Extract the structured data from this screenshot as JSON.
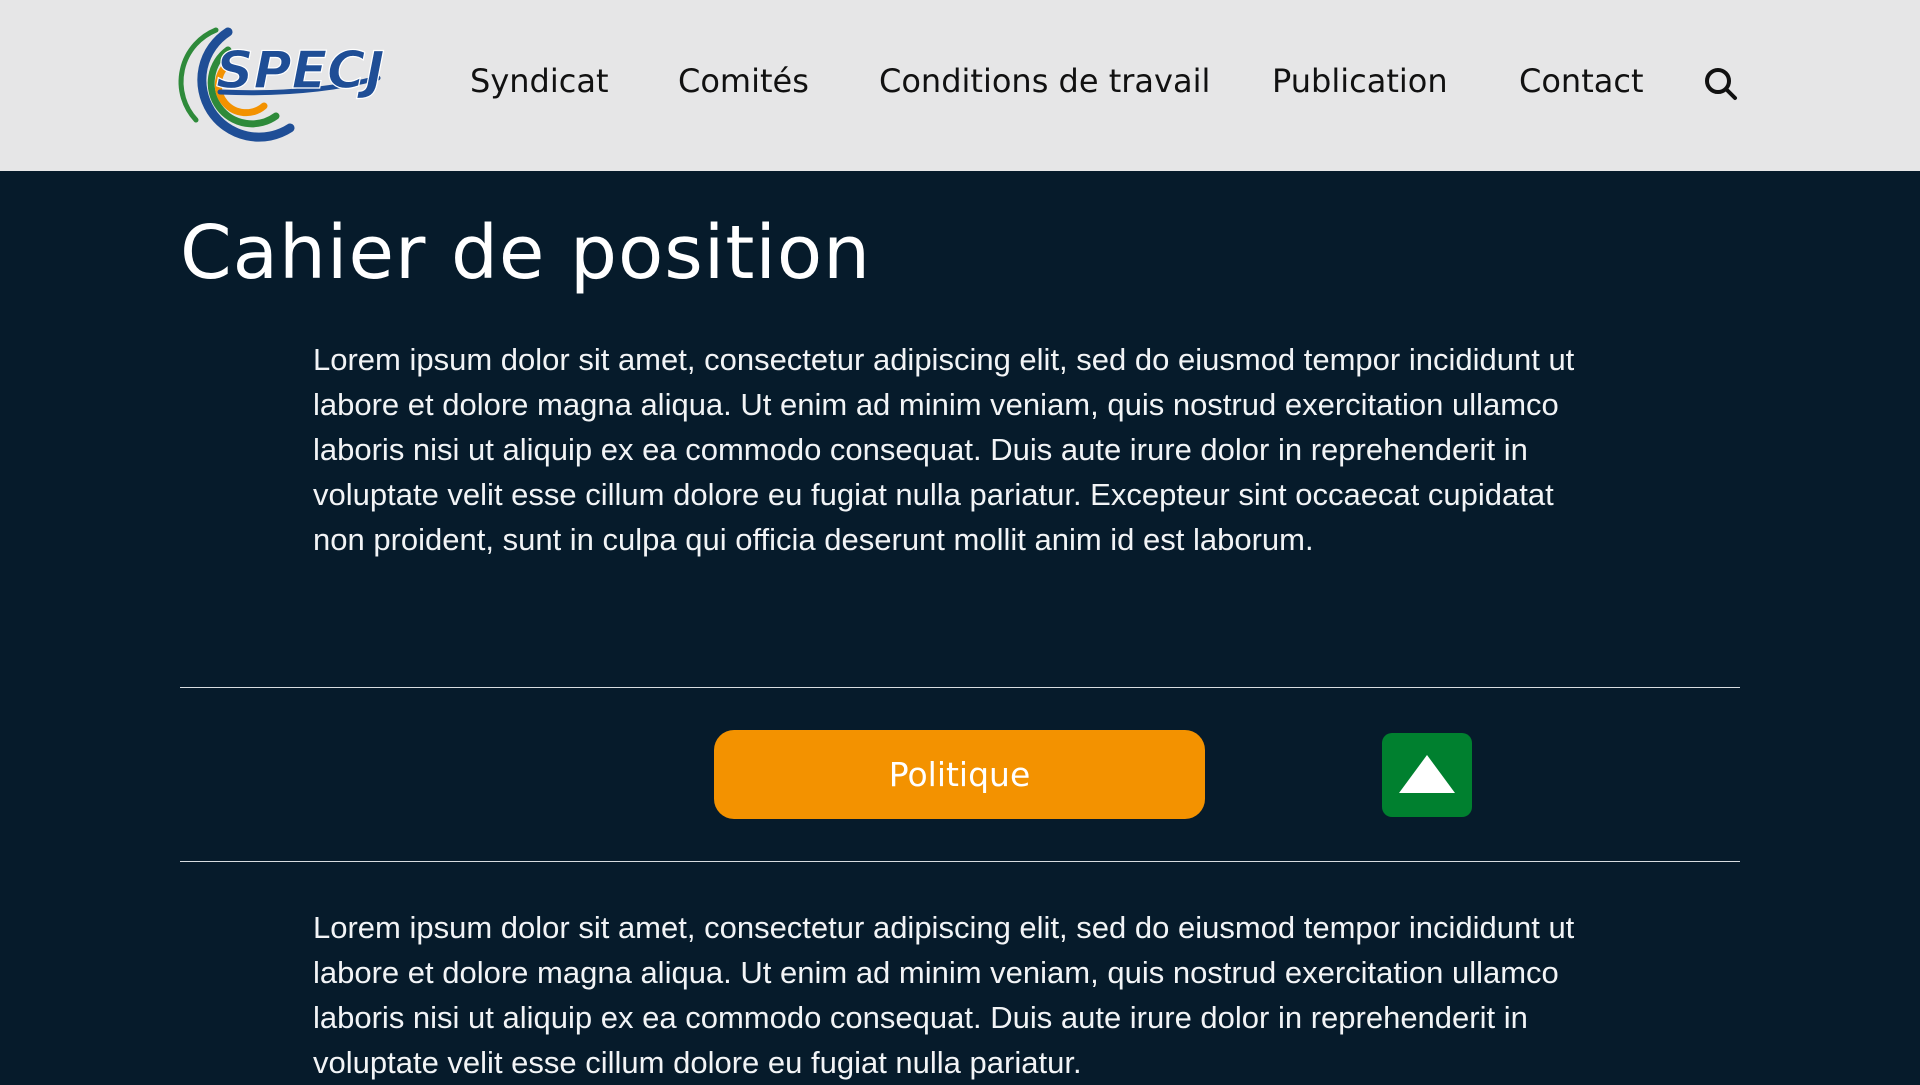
{
  "header": {
    "logo_text": "SPECJ",
    "nav": [
      {
        "label": "Syndicat"
      },
      {
        "label": "Comités"
      },
      {
        "label": "Conditions de travail"
      },
      {
        "label": "Publication"
      },
      {
        "label": "Contact"
      }
    ],
    "search_icon": "search-icon"
  },
  "main": {
    "title": "Cahier de position",
    "paragraph_1": "Lorem ipsum dolor sit amet, consectetur adipiscing elit, sed do eiusmod tempor incididunt ut labore et dolore magna aliqua. Ut enim ad minim veniam, quis nostrud exercitation ullamco laboris nisi ut aliquip ex ea commodo consequat. Duis aute irure dolor in reprehenderit in voluptate velit esse cillum dolore eu fugiat nulla pariatur. Excepteur sint occaecat cupidatat non proident, sunt in culpa qui officia deserunt mollit anim id est laborum.",
    "section_button": "Politique",
    "toggle_icon": "triangle-up-icon",
    "paragraph_2": "Lorem ipsum dolor sit amet, consectetur adipiscing elit, sed do eiusmod tempor incididunt ut labore et dolore magna aliqua. Ut enim ad minim veniam, quis nostrud exercitation ullamco laboris nisi ut aliquip ex ea commodo consequat. Duis aute irure dolor in reprehenderit in voluptate velit esse cillum dolore eu fugiat nulla pariatur."
  },
  "colors": {
    "header_bg": "#e6e6e7",
    "page_bg": "#061b2b",
    "accent_orange": "#f39200",
    "accent_green": "#00802f",
    "logo_blue": "#1f4e96"
  }
}
